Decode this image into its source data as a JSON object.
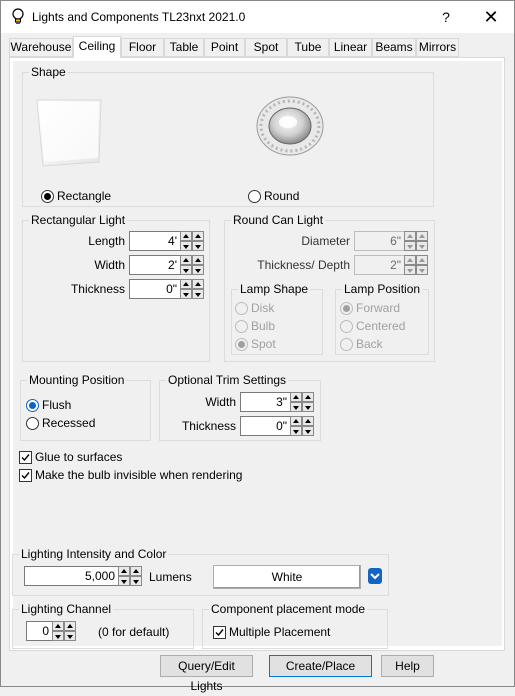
{
  "window": {
    "title": "Lights and Components  TL23nxt 2021.0",
    "help_glyph": "?",
    "close_glyph": "✕"
  },
  "tabs": [
    "Warehouse",
    "Ceiling",
    "Floor",
    "Table",
    "Point",
    "Spot",
    "Tube",
    "Linear",
    "Beams",
    "Mirrors"
  ],
  "active_tab": "Ceiling",
  "shape": {
    "label": "Shape",
    "options": [
      "Rectangle",
      "Round"
    ],
    "selected": "Rectangle"
  },
  "rect_light": {
    "label": "Rectangular Light",
    "length_label": "Length",
    "length_value": "4'",
    "width_label": "Width",
    "width_value": "2'",
    "thickness_label": "Thickness",
    "thickness_value": "0\""
  },
  "round_light": {
    "label": "Round Can Light",
    "diameter_label": "Diameter",
    "diameter_value": "6\"",
    "depth_label": "Thickness/ Depth",
    "depth_value": "2\"",
    "lamp_shape": {
      "label": "Lamp Shape",
      "options": [
        "Disk",
        "Bulb",
        "Spot"
      ],
      "selected": "Spot"
    },
    "lamp_position": {
      "label": "Lamp Position",
      "options": [
        "Forward",
        "Centered",
        "Back"
      ],
      "selected": "Forward"
    }
  },
  "mounting": {
    "label": "Mounting Position",
    "options": [
      "Flush",
      "Recessed"
    ],
    "selected": "Flush"
  },
  "trim": {
    "label": "Optional Trim Settings",
    "width_label": "Width",
    "width_value": "3\"",
    "thickness_label": "Thickness",
    "thickness_value": "0\""
  },
  "checks": {
    "glue_label": "Glue to surfaces",
    "glue_checked": true,
    "invisible_label": "Make the bulb invisible when rendering",
    "invisible_checked": true
  },
  "intensity": {
    "label": "Lighting Intensity and Color",
    "value": "5,000",
    "unit": "Lumens",
    "color_name": "White"
  },
  "channel": {
    "label": "Lighting Channel",
    "value": "0",
    "hint": "(0 for default)"
  },
  "placement": {
    "label": "Component placement mode",
    "multiple_label": "Multiple Placement",
    "multiple_checked": true
  },
  "buttons": {
    "query": "Query/Edit Lights",
    "create": "Create/Place",
    "help": "Help"
  },
  "icons": {
    "app": "lightbulb-icon",
    "dropdown": "chevron-down-icon"
  }
}
